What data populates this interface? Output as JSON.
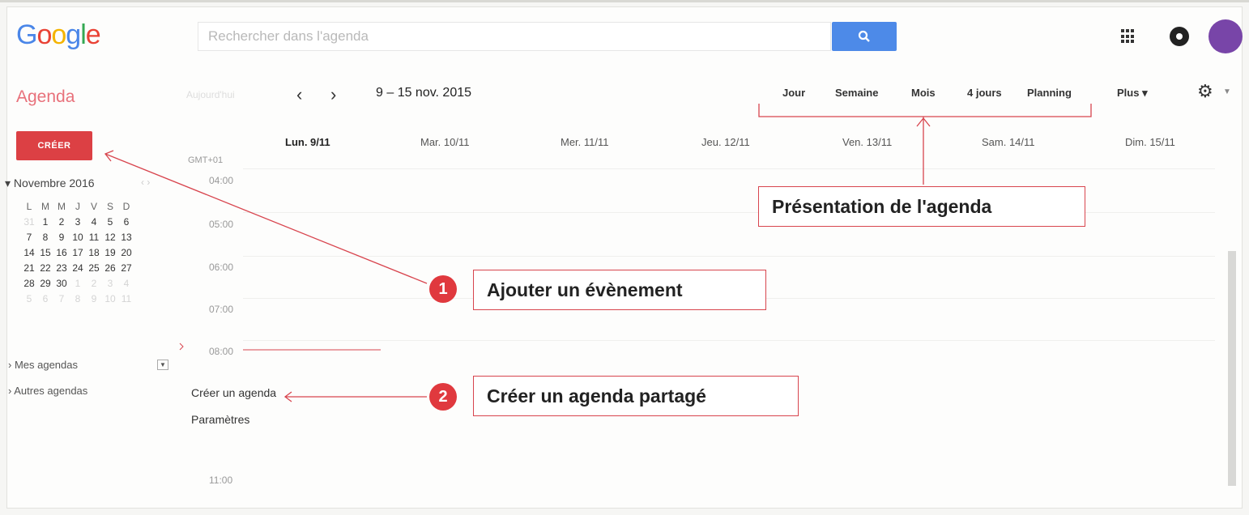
{
  "brand": {
    "letters": [
      "G",
      "o",
      "o",
      "g",
      "l",
      "e"
    ],
    "colors": [
      "#4a86e8",
      "#e94235",
      "#f4b400",
      "#4a86e8",
      "#34a853",
      "#e94235"
    ]
  },
  "search": {
    "placeholder": "Rechercher dans l'agenda"
  },
  "app_title": "Agenda",
  "toolbar": {
    "today_label": "Aujourd'hui",
    "prev_label": "‹",
    "next_label": "›",
    "date_range": "9 – 15 nov. 2015",
    "views": [
      "Jour",
      "Semaine",
      "Mois",
      "4 jours",
      "Planning"
    ],
    "more_label": "Plus ▾"
  },
  "create_button_label": "CRÉER",
  "mini_calendar": {
    "title": "▾ Novembre 2016",
    "nav": "‹ ›",
    "weekday_headers": [
      "L",
      "M",
      "M",
      "J",
      "V",
      "S",
      "D"
    ],
    "weeks": [
      [
        "31",
        "1",
        "2",
        "3",
        "4",
        "5",
        "6"
      ],
      [
        "7",
        "8",
        "9",
        "10",
        "11",
        "12",
        "13"
      ],
      [
        "14",
        "15",
        "16",
        "17",
        "18",
        "19",
        "20"
      ],
      [
        "21",
        "22",
        "23",
        "24",
        "25",
        "26",
        "27"
      ],
      [
        "28",
        "29",
        "30",
        "1",
        "2",
        "3",
        "4"
      ],
      [
        "5",
        "6",
        "7",
        "8",
        "9",
        "10",
        "11"
      ]
    ]
  },
  "sidebar": {
    "my_calendars": "› Mes agendas",
    "other_calendars": "› Autres agendas"
  },
  "dropdown_menu": {
    "items": [
      "Créer un agenda",
      "Paramètres"
    ]
  },
  "timezone": "GMT+01",
  "hours": [
    "04:00",
    "05:00",
    "06:00",
    "07:00",
    "08:00",
    "11:00"
  ],
  "day_headers": [
    "Lun. 9/11",
    "Mar. 10/11",
    "Mer. 11/11",
    "Jeu. 12/11",
    "Ven. 13/11",
    "Sam. 14/11",
    "Dim. 15/11"
  ],
  "annotations": {
    "view_label": "Présentation de l'agenda",
    "add_event": {
      "number": "1",
      "label": "Ajouter un évènement"
    },
    "shared_calendar": {
      "number": "2",
      "label": "Créer un agenda partagé"
    }
  },
  "accent_colors": {
    "red": "#dc4044",
    "search_blue": "#4d8ae8",
    "avatar": "#7845a8"
  }
}
